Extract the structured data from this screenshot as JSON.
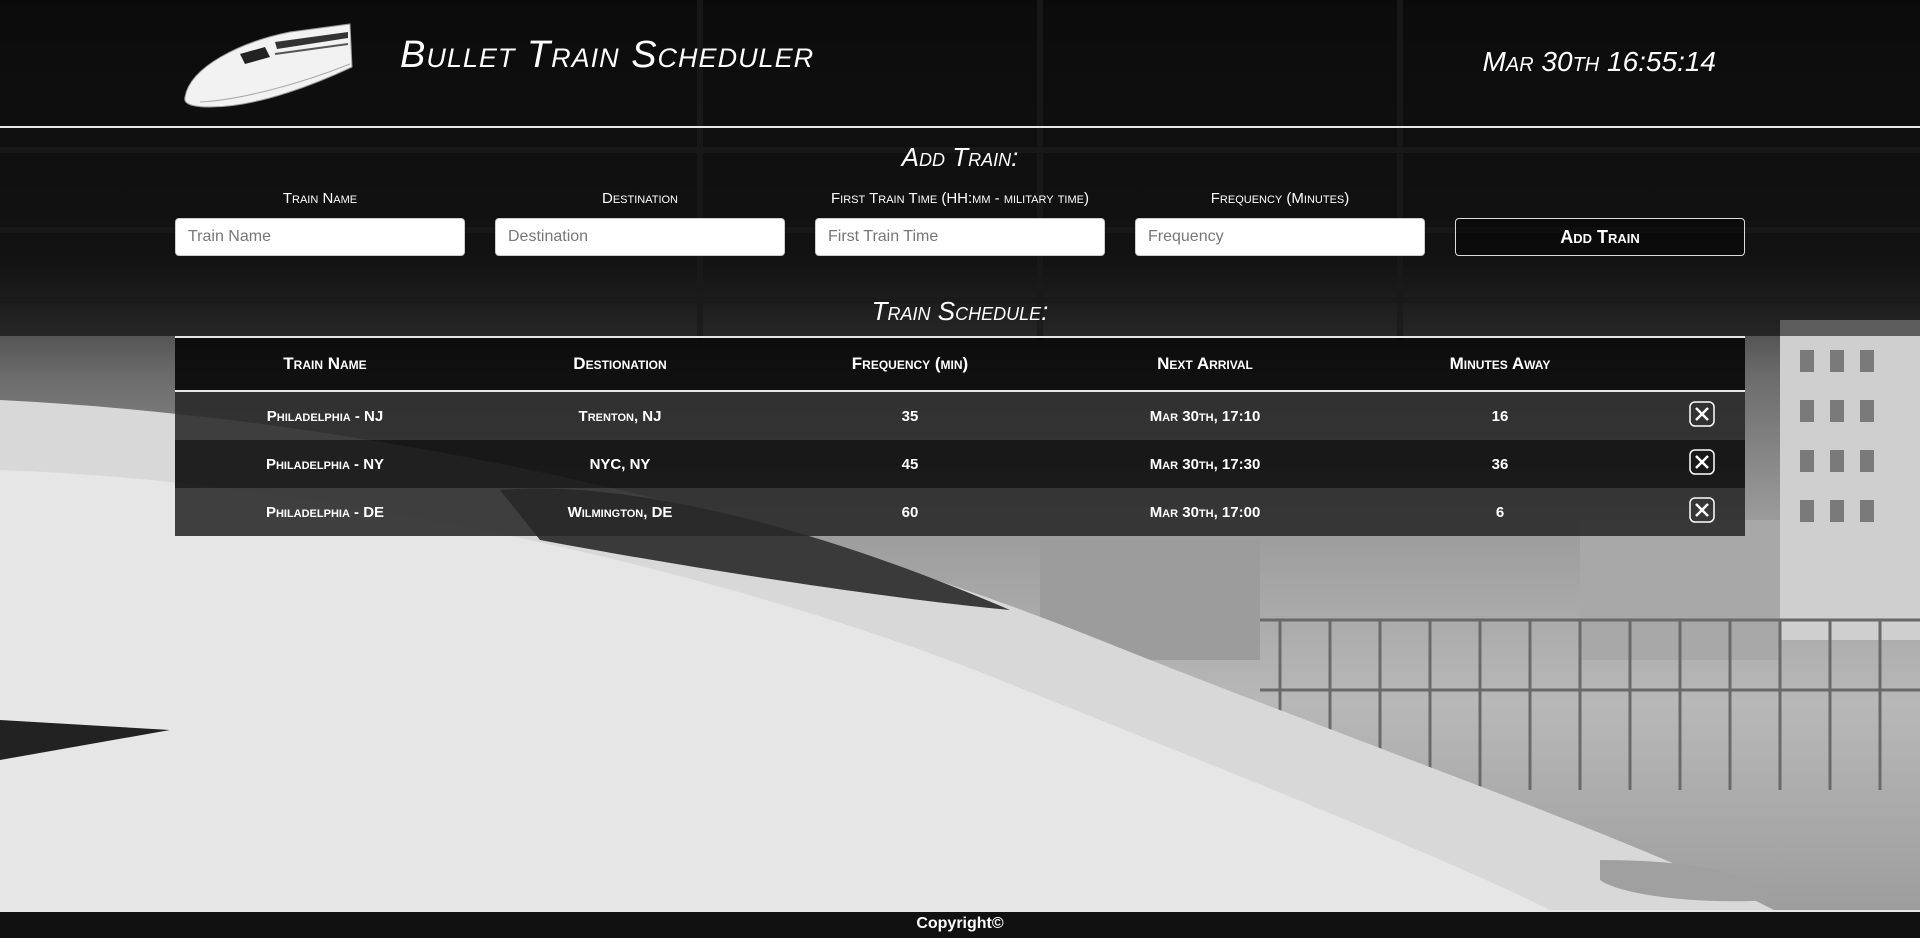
{
  "header": {
    "title": "Bullet Train Scheduler",
    "clock": "Mar 30th 16:55:14"
  },
  "add_train": {
    "title": "Add Train:",
    "fields": [
      {
        "label": "Train Name",
        "placeholder": "Train Name",
        "value": ""
      },
      {
        "label": "Destination",
        "placeholder": "Destination",
        "value": ""
      },
      {
        "label": "First Train Time (HH:mm - military time)",
        "placeholder": "First Train Time",
        "value": ""
      },
      {
        "label": "Frequency (Minutes)",
        "placeholder": "Frequency",
        "value": ""
      }
    ],
    "button_label": "Add Train"
  },
  "schedule": {
    "title": "Train Schedule:",
    "columns": [
      "Train Name",
      "Destionation",
      "Frequency (min)",
      "Next Arrival",
      "Minutes Away"
    ],
    "rows": [
      {
        "name": "Philadelphia - NJ",
        "destination": "Trenton, NJ",
        "frequency": "35",
        "next_arrival": "Mar 30th, 17:10",
        "minutes_away": "16"
      },
      {
        "name": "Philadelphia - NY",
        "destination": "NYC, NY",
        "frequency": "45",
        "next_arrival": "Mar 30th, 17:30",
        "minutes_away": "36"
      },
      {
        "name": "Philadelphia - DE",
        "destination": "Wilmington, DE",
        "frequency": "60",
        "next_arrival": "Mar 30th, 17:00",
        "minutes_away": "6"
      }
    ],
    "delete_icon": "close-x-icon"
  },
  "footer": {
    "text": "Copyright©"
  }
}
